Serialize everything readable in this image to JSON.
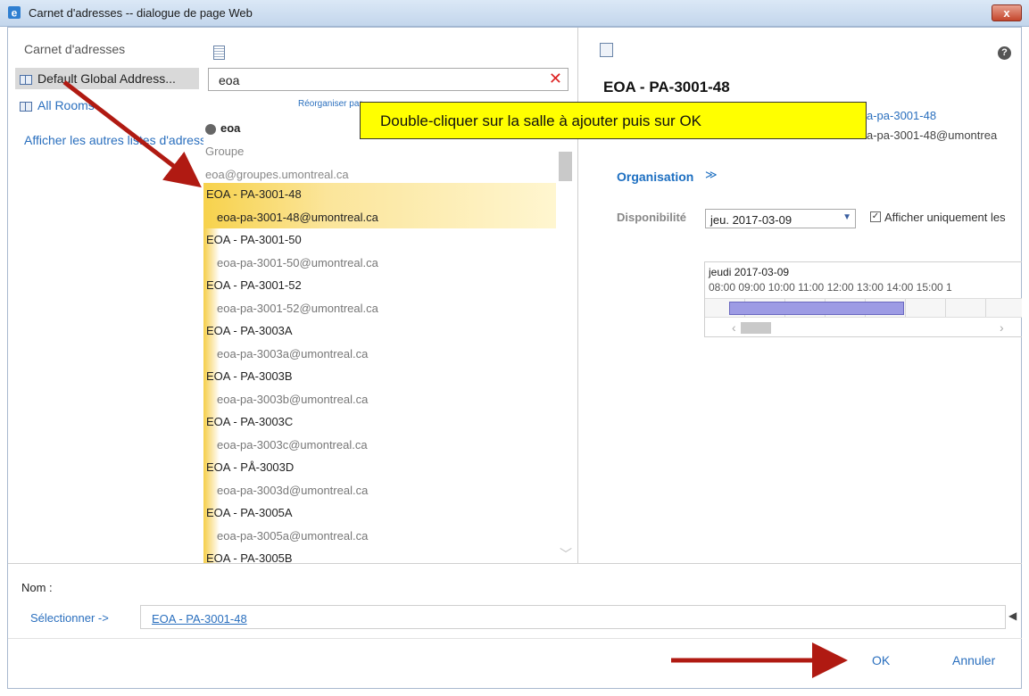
{
  "window": {
    "title": "Carnet d'adresses -- dialogue de page Web",
    "close_label": "x",
    "icon": "ie-icon"
  },
  "left_pane": {
    "header": "Carnet d'adresses",
    "items": [
      {
        "label": "Default Global Address...",
        "icon": "book-icon",
        "selected": true
      },
      {
        "label": "All Rooms",
        "icon": "book-icon",
        "selected": false
      }
    ],
    "other_lists_link": "Afficher les autres listes d'adresses"
  },
  "middle_pane": {
    "search": {
      "value": "eoa",
      "clear_label": "✕"
    },
    "reorganize_link": "Réorganiser par",
    "group_result": {
      "name": "eoa",
      "type": "Groupe",
      "email": "eoa@groupes.umontreal.ca"
    },
    "rooms": [
      {
        "name": "EOA - PA-3001-48",
        "email": "eoa-pa-3001-48@umontreal.ca",
        "selected": true
      },
      {
        "name": "EOA - PA-3001-50",
        "email": "eoa-pa-3001-50@umontreal.ca",
        "selected": false
      },
      {
        "name": "EOA - PA-3001-52",
        "email": "eoa-pa-3001-52@umontreal.ca",
        "selected": false
      },
      {
        "name": "EOA - PA-3003A",
        "email": "eoa-pa-3003a@umontreal.ca",
        "selected": false
      },
      {
        "name": "EOA - PA-3003B",
        "email": "eoa-pa-3003b@umontreal.ca",
        "selected": false
      },
      {
        "name": "EOA - PA-3003C",
        "email": "eoa-pa-3003c@umontreal.ca",
        "selected": false
      },
      {
        "name": "EOA - PÅ-3003D",
        "email": "eoa-pa-3003d@umontreal.ca",
        "selected": false
      },
      {
        "name": "EOA - PA-3005A",
        "email": "eoa-pa-3005a@umontreal.ca",
        "selected": false
      },
      {
        "name": "EOA - PA-3005B",
        "email": "",
        "selected": false
      }
    ]
  },
  "right_pane": {
    "contact_name": "EOA - PA-3001-48",
    "alias_fragment": "a-pa-3001-48",
    "email_fragment": "a-pa-3001-48@umontrea",
    "organisation_label": "Organisation",
    "organisation_chevron": "≫",
    "availability_label": "Disponibilité",
    "date_value": "jeu. 2017-03-09",
    "checkbox_label": "Afficher uniquement les",
    "checkbox_checked": true,
    "schedule": {
      "day": "jeudi 2017-03-09",
      "hours": "08:00  09:00  10:00  11:00  12:00  13:00  14:00  15:00  1"
    },
    "help_label": "?"
  },
  "bottom": {
    "name_label": "Nom :",
    "select_button": "Sélectionner ->",
    "selected_value": "EOA - PA-3001-48",
    "ok_label": "OK",
    "cancel_label": "Annuler"
  },
  "annotation": {
    "callout_text": "Double-cliquer sur la salle à ajouter puis sur OK",
    "arrow_color": "#b01a12",
    "callout_color": "#ffff00"
  }
}
